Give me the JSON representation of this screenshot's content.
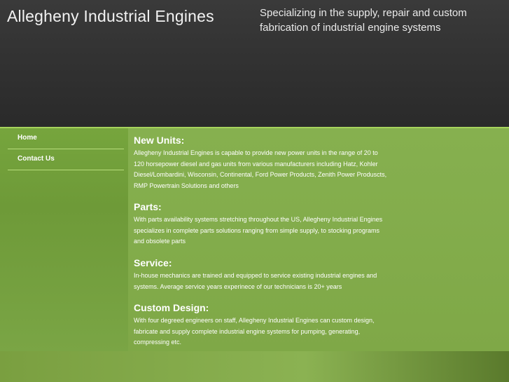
{
  "header": {
    "site_title": "Allegheny Industrial Engines",
    "tagline": "Specializing in the supply, repair and custom fabrication of industrial engine systems"
  },
  "nav": {
    "items": [
      {
        "label": "Home"
      },
      {
        "label": "Contact Us"
      }
    ]
  },
  "sections": [
    {
      "heading": "New Units:",
      "body": "Allegheny Industrial Engines is capable to provide new power units in the range of 20 to 120 horsepower diesel and gas units from various manufacturers including Hatz, Kohler Diesel/Lombardini, Wisconsin, Continental, Ford Power Products, Zenith Power Produscts, RMP Powertrain Solutions and others"
    },
    {
      "heading": "Parts:",
      "body": "With parts availability systems stretching throughout the US, Allegheny Industrial Engines specializes in complete parts solutions ranging from simple supply, to stocking programs and obsolete parts"
    },
    {
      "heading": "Service:",
      "body": "In-house mechanics are trained and equipped to service existing industrial engines and systems. Average service years experinece of our technicians is 20+ years"
    },
    {
      "heading": "Custom Design:",
      "body": "With four degreed engineers on staff, Allegheny Industrial Engines can custom design, fabricate and supply complete industrial engine systems for pumping, generating, compressing etc."
    }
  ]
}
